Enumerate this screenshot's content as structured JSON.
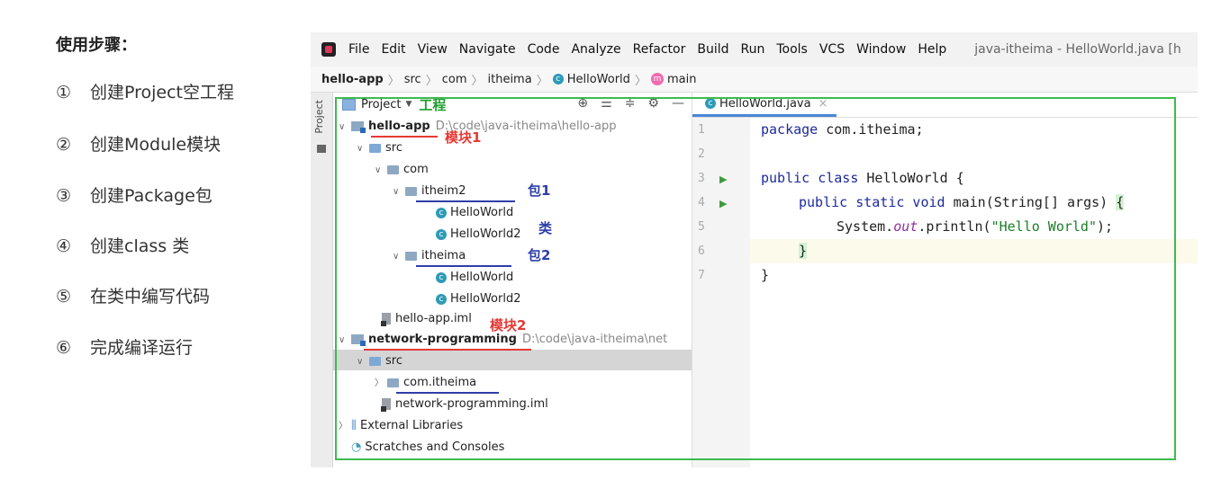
{
  "steps": {
    "title": "使用步骤：",
    "items": [
      {
        "num": "①",
        "text": "创建Project空工程"
      },
      {
        "num": "②",
        "text": "创建Module模块"
      },
      {
        "num": "③",
        "text": "创建Package包"
      },
      {
        "num": "④",
        "text": "创建class 类"
      },
      {
        "num": "⑤",
        "text": "在类中编写代码"
      },
      {
        "num": "⑥",
        "text": "完成编译运行"
      }
    ]
  },
  "menubar": {
    "items": [
      "File",
      "Edit",
      "View",
      "Navigate",
      "Code",
      "Analyze",
      "Refactor",
      "Build",
      "Run",
      "Tools",
      "VCS",
      "Window",
      "Help"
    ],
    "window_title": "java-itheima - HelloWorld.java [h"
  },
  "navbar": {
    "project": "hello-app",
    "src": "src",
    "com": "com",
    "pkg": "itheima",
    "cls": "HelloWorld",
    "method": "main"
  },
  "sidestrip": {
    "label": "Project"
  },
  "project_panel": {
    "title": "Project",
    "title_annotation": "工程",
    "rows": {
      "hello_app": "hello-app",
      "hello_app_path": "D:\\code\\java-itheima\\hello-app",
      "src": "src",
      "com": "com",
      "itheim2": "itheim2",
      "hw1": "HelloWorld",
      "hw2": "HelloWorld2",
      "itheima": "itheima",
      "hw3": "HelloWorld",
      "hw4": "HelloWorld2",
      "iml": "hello-app.iml",
      "network": "network-programming",
      "network_path": "D:\\code\\java-itheima\\net",
      "src2": "src",
      "comitheima": "com.itheima",
      "iml2": "network-programming.iml",
      "extlib": "External Libraries",
      "scratches": "Scratches and Consoles"
    },
    "annotations": {
      "module1": "模块1",
      "module2": "模块2",
      "pkg1": "包1",
      "pkg2": "包2",
      "cls": "类"
    }
  },
  "editor": {
    "tab": "HelloWorld.java",
    "line_numbers": [
      "1",
      "2",
      "3",
      "4",
      "5",
      "6",
      "7"
    ],
    "code": {
      "l1_kw": "package",
      "l1_rest": " com.itheima;",
      "l3_kw": "public class",
      "l3_rest": " HelloWorld {",
      "l4_kw": "public static void",
      "l4_rest": " main(String[] args) ",
      "l4_brace": "{",
      "l5_a": "System.",
      "l5_fld": "out",
      "l5_b": ".println(",
      "l5_str": "\"Hello World\"",
      "l5_c": ");",
      "l6": "}",
      "l7": "}"
    }
  },
  "colors": {
    "annotation_red": "#e53935",
    "annotation_blue": "#2d3ea8",
    "annotation_green": "#1e9e2e",
    "box_green": "#3dbb4f"
  }
}
